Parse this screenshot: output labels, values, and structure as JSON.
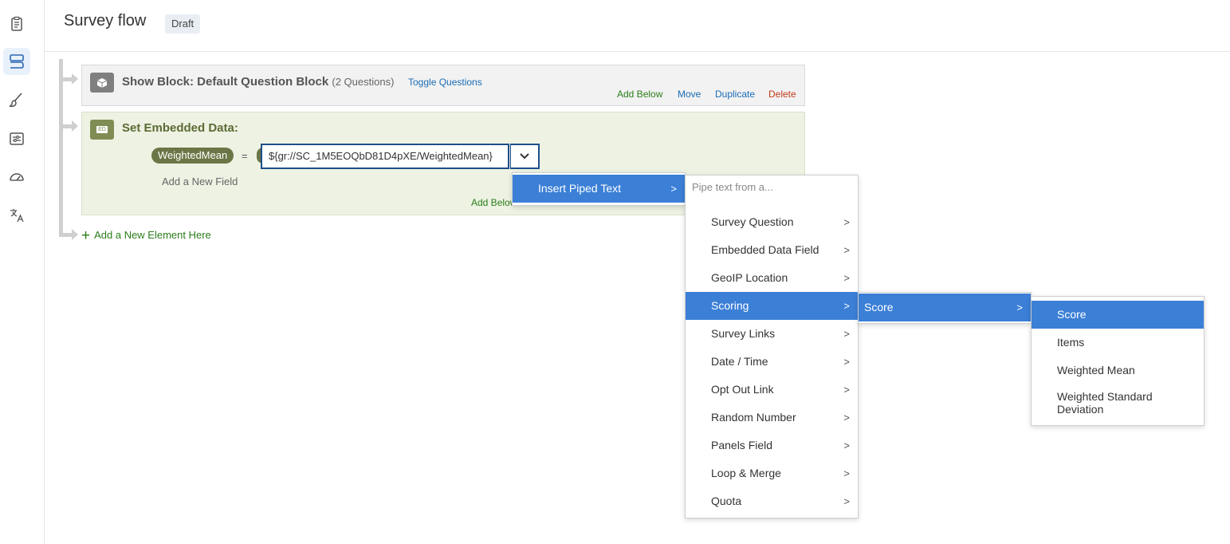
{
  "header": {
    "title": "Survey flow",
    "status": "Draft"
  },
  "sidebar": {
    "icons": [
      "clipboard-icon",
      "survey-flow-icon",
      "brush-icon",
      "options-icon",
      "dashboard-icon",
      "translate-icon"
    ]
  },
  "show_block": {
    "title": "Show Block: Default Question Block",
    "question_count": "(2 Questions)",
    "toggle": "Toggle Questions",
    "actions": {
      "add_below": "Add Below",
      "move": "Move",
      "duplicate": "Duplicate",
      "delete": "Delete"
    }
  },
  "embedded_block": {
    "icon_label": "ED",
    "title": "Set Embedded Data:",
    "field_name": "WeightedMean",
    "equals": "=",
    "field_value": "${gr://SC_1M5EOQbD81D4pXE/WeightedMean}",
    "add_field": "Add a New Field",
    "add_below": "Add Below"
  },
  "add_element": "Add a New Element Here",
  "menus": {
    "insert": {
      "label": "Insert Piped Text"
    },
    "pipe": {
      "placeholder": "Pipe text from a...",
      "items": [
        "Survey Question",
        "Embedded Data Field",
        "GeoIP Location",
        "Scoring",
        "Survey Links",
        "Date / Time",
        "Opt Out Link",
        "Random Number",
        "Panels Field",
        "Loop & Merge",
        "Quota"
      ],
      "selected": "Scoring"
    },
    "scoring": {
      "items": [
        "Score"
      ]
    },
    "score": {
      "items": [
        "Score",
        "Items",
        "Weighted Mean",
        "Weighted Standard Deviation"
      ],
      "selected": "Score"
    }
  },
  "colors": {
    "accent": "#3b7fd6",
    "ed_green": "#7f8d55",
    "link_green": "#2a7d1a",
    "delete_red": "#c0391b"
  }
}
